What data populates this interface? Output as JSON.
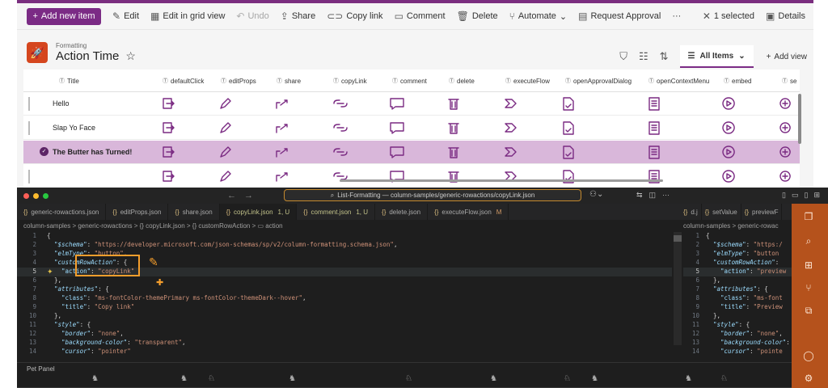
{
  "sharepoint": {
    "command_bar": {
      "new_label": "Add new item",
      "edit_label": "Edit",
      "grid_label": "Edit in grid view",
      "undo_label": "Undo",
      "share_label": "Share",
      "copy_link_label": "Copy link",
      "comment_label": "Comment",
      "delete_label": "Delete",
      "automate_label": "Automate",
      "approval_label": "Request Approval",
      "more_label": "···",
      "selected_label": "1 selected",
      "details_label": "Details"
    },
    "list": {
      "crumb": "Formatting",
      "title": "Action Time"
    },
    "view": {
      "all_items": "All Items",
      "add_view": "Add view"
    },
    "columns": [
      "Title",
      "defaultClick",
      "editProps",
      "share",
      "copyLink",
      "comment",
      "delete",
      "executeFlow",
      "openApprovalDialog",
      "openContextMenu",
      "embed",
      "se"
    ],
    "rows": [
      {
        "title": "Hello",
        "selected": false
      },
      {
        "title": "Slap Yo Face",
        "selected": false
      },
      {
        "title": "The Butter has Turned!",
        "selected": true
      },
      {
        "title": "",
        "selected": false
      }
    ],
    "accent": "#7b2b85",
    "selected_row_color": "#d9b7da",
    "logo_color": "#d5461e"
  },
  "vscode": {
    "command_center": "List-Formatting — column-samples/generic-rowactions/copyLink.json",
    "tabs": [
      {
        "name": "generic-rowactions.json",
        "badge": ""
      },
      {
        "name": "editProps.json",
        "badge": ""
      },
      {
        "name": "share.json",
        "badge": ""
      },
      {
        "name": "copyLink.json",
        "badge": "1, U"
      },
      {
        "name": "comment.json",
        "badge": "1, U"
      },
      {
        "name": "delete.json",
        "badge": ""
      },
      {
        "name": "executeFlow.json",
        "badge": "M"
      }
    ],
    "split_tabs": [
      {
        "name": "d.j"
      },
      {
        "name": "setValue"
      },
      {
        "name": "previewF"
      }
    ],
    "breadcrumb": "column-samples > generic-rowactions > {} copyLink.json > {} customRowAction > ▭ action",
    "breadcrumb_right": "column-samples > generic-rowac",
    "line_numbers": [
      "1",
      "2",
      "3",
      "4",
      "5",
      "6",
      "7",
      "8",
      "9",
      "10",
      "11",
      "12",
      "13",
      "14"
    ],
    "code_lines": [
      {
        "parts": [
          {
            "c": "p",
            "t": "{"
          }
        ]
      },
      {
        "parts": [
          {
            "c": "ki",
            "t": "\"$schema\""
          },
          {
            "c": "p",
            "t": ": "
          },
          {
            "c": "s",
            "t": "\"https://developer.microsoft.com/json-schemas/sp/v2/column-formatting.schema.json\""
          },
          {
            "c": "p",
            "t": ","
          }
        ]
      },
      {
        "parts": [
          {
            "c": "ki",
            "t": "\"elmType\""
          },
          {
            "c": "p",
            "t": ": "
          },
          {
            "c": "s",
            "t": "\"button\""
          },
          {
            "c": "p",
            "t": ","
          }
        ]
      },
      {
        "parts": [
          {
            "c": "ki",
            "t": "\"customRowAction\""
          },
          {
            "c": "p",
            "t": ": {"
          }
        ]
      },
      {
        "parts": [
          {
            "c": "k",
            "t": "\"action\""
          },
          {
            "c": "p",
            "t": ": "
          },
          {
            "c": "s",
            "t": "\"copyLink\""
          }
        ]
      },
      {
        "parts": [
          {
            "c": "p",
            "t": "},"
          }
        ]
      },
      {
        "parts": [
          {
            "c": "ki",
            "t": "\"attributes\""
          },
          {
            "c": "p",
            "t": ": {"
          }
        ]
      },
      {
        "parts": [
          {
            "c": "k",
            "t": "\"class\""
          },
          {
            "c": "p",
            "t": ": "
          },
          {
            "c": "s",
            "t": "\"ms-fontColor-themePrimary ms-fontColor-themeDark--hover\""
          },
          {
            "c": "p",
            "t": ","
          }
        ]
      },
      {
        "parts": [
          {
            "c": "k",
            "t": "\"title\""
          },
          {
            "c": "p",
            "t": ": "
          },
          {
            "c": "s",
            "t": "\"Copy link\""
          }
        ]
      },
      {
        "parts": [
          {
            "c": "p",
            "t": "},"
          }
        ]
      },
      {
        "parts": [
          {
            "c": "ki",
            "t": "\"style\""
          },
          {
            "c": "p",
            "t": ": {"
          }
        ]
      },
      {
        "parts": [
          {
            "c": "ki",
            "t": "\"border\""
          },
          {
            "c": "p",
            "t": ": "
          },
          {
            "c": "s",
            "t": "\"none\""
          },
          {
            "c": "p",
            "t": ","
          }
        ]
      },
      {
        "parts": [
          {
            "c": "ki",
            "t": "\"background-color\""
          },
          {
            "c": "p",
            "t": ": "
          },
          {
            "c": "s",
            "t": "\"transparent\""
          },
          {
            "c": "p",
            "t": ","
          }
        ]
      },
      {
        "parts": [
          {
            "c": "ki",
            "t": "\"cursor\""
          },
          {
            "c": "p",
            "t": ": "
          },
          {
            "c": "s",
            "t": "\"pointer\""
          }
        ]
      }
    ],
    "right_code_lines": [
      {
        "parts": [
          {
            "c": "p",
            "t": "{"
          }
        ]
      },
      {
        "parts": [
          {
            "c": "ki",
            "t": "\"$schema\""
          },
          {
            "c": "p",
            "t": ": "
          },
          {
            "c": "s",
            "t": "\"https:/"
          }
        ]
      },
      {
        "parts": [
          {
            "c": "ki",
            "t": "\"elmType\""
          },
          {
            "c": "p",
            "t": ": "
          },
          {
            "c": "s",
            "t": "\"button"
          }
        ]
      },
      {
        "parts": [
          {
            "c": "ki",
            "t": "\"customRowAction\""
          },
          {
            "c": "p",
            "t": ": "
          }
        ]
      },
      {
        "parts": [
          {
            "c": "k",
            "t": "\"action\""
          },
          {
            "c": "p",
            "t": ": "
          },
          {
            "c": "s",
            "t": "\"preview"
          }
        ]
      },
      {
        "parts": [
          {
            "c": "p",
            "t": "},"
          }
        ]
      },
      {
        "parts": [
          {
            "c": "ki",
            "t": "\"attributes\""
          },
          {
            "c": "p",
            "t": ": {"
          }
        ]
      },
      {
        "parts": [
          {
            "c": "k",
            "t": "\"class\""
          },
          {
            "c": "p",
            "t": ": "
          },
          {
            "c": "s",
            "t": "\"ms-font"
          }
        ]
      },
      {
        "parts": [
          {
            "c": "k",
            "t": "\"title\""
          },
          {
            "c": "p",
            "t": ": "
          },
          {
            "c": "s",
            "t": "\"Preview"
          }
        ]
      },
      {
        "parts": [
          {
            "c": "p",
            "t": "},"
          }
        ]
      },
      {
        "parts": [
          {
            "c": "ki",
            "t": "\"style\""
          },
          {
            "c": "p",
            "t": ": {"
          }
        ]
      },
      {
        "parts": [
          {
            "c": "ki",
            "t": "\"border\""
          },
          {
            "c": "p",
            "t": ": "
          },
          {
            "c": "s",
            "t": "\"none\""
          },
          {
            "c": "p",
            "t": ","
          }
        ]
      },
      {
        "parts": [
          {
            "c": "ki",
            "t": "\"background-color\""
          },
          {
            "c": "p",
            "t": ": "
          }
        ]
      },
      {
        "parts": [
          {
            "c": "ki",
            "t": "\"cursor\""
          },
          {
            "c": "p",
            "t": ": "
          },
          {
            "c": "s",
            "t": "\"pointe"
          }
        ]
      }
    ],
    "pet_panel": "Pet Panel",
    "activity_color": "#b5521c"
  }
}
